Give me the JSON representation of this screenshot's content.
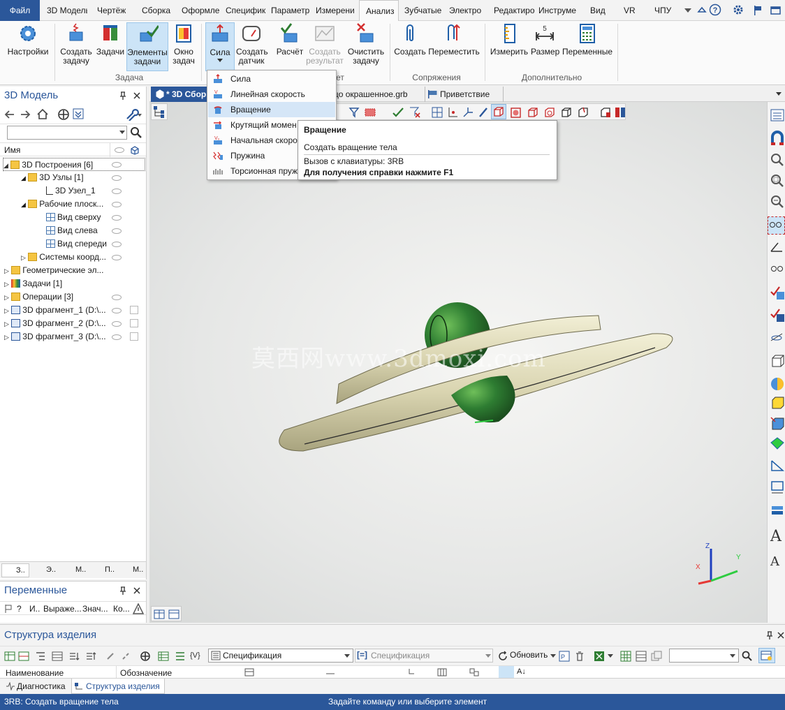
{
  "menu": {
    "file": "Файл",
    "items": [
      "3D Модель",
      "Чертёж",
      "Сборка",
      "Оформле",
      "Специфик",
      "Параметр",
      "Измерени",
      "Анализ",
      "Зубчатые",
      "Электро",
      "Редактиро",
      "Инструме",
      "Вид",
      "VR",
      "ЧПУ"
    ]
  },
  "ribbon": {
    "buttons": [
      "Настройки",
      "Создать задачу",
      "Задачи",
      "Элементы задачи",
      "Окно задач",
      "Сила",
      "Создать датчик",
      "Расчёт",
      "Создать результат",
      "Очистить задачу",
      "Создать",
      "Переместить",
      "Измерить",
      "Размер",
      "Переменные"
    ],
    "groups": [
      "Задача",
      "ет",
      "Сопряжения",
      "Дополнительно"
    ]
  },
  "left_panel": {
    "title": "3D Модель",
    "col_name": "Имя",
    "tree": [
      "3D Построения [6]",
      "3D Узлы [1]",
      "3D Узел_1",
      "Рабочие плоск...",
      "Вид сверху",
      "Вид слева",
      "Вид спереди",
      "Системы коорд...",
      "Геометрические эл...",
      "Задачи [1]",
      "Операции [3]",
      "3D фрагмент_1 (D:\\...",
      "3D фрагмент_2 (D:\\...",
      "3D фрагмент_3 (D:\\..."
    ],
    "bottom_tabs": [
      "З..",
      "Э..",
      "М..",
      "П..",
      "М.."
    ]
  },
  "variables_panel": {
    "title": "Переменные",
    "columns": [
      "?",
      "И..",
      "Выраже...",
      "Знач...",
      "Ко..."
    ]
  },
  "doc_tabs": [
    "* 3D Сбор",
    "цо окрашенное.grb",
    "Приветствие"
  ],
  "dropdown": {
    "items": [
      "Сила",
      "Линейная скорость",
      "Вращение",
      "Крутящий момен",
      "Начальная скоро",
      "Пружина",
      "Торсионная пруж"
    ],
    "highlighted": 2
  },
  "tooltip": {
    "title": "Вращение",
    "description": "Создать вращение тела",
    "shortcut": "Вызов с клавиатуры: 3RB",
    "help": "Для получения справки нажмите F1"
  },
  "watermark": "莫西网www.3dmoxi.com",
  "axes": {
    "x": "X",
    "y": "Y",
    "z": "Z"
  },
  "structure": {
    "title": "Структура изделия",
    "spec_dropdown": "Спецификация",
    "spec_dropdown2": "Спецификация",
    "refresh": "Обновить",
    "col_name": "Наименование",
    "col_designation": "Обозначение",
    "tabs": [
      "Диагностика",
      "Структура изделия"
    ]
  },
  "status": {
    "left": "3RB: Создать вращение тела",
    "center": "Задайте команду или выберите элемент"
  },
  "colors": {
    "accent": "#2b579a",
    "highlight": "#d5e6f7",
    "ring": "#ddd8b4",
    "sphere": "#2e7d32"
  }
}
